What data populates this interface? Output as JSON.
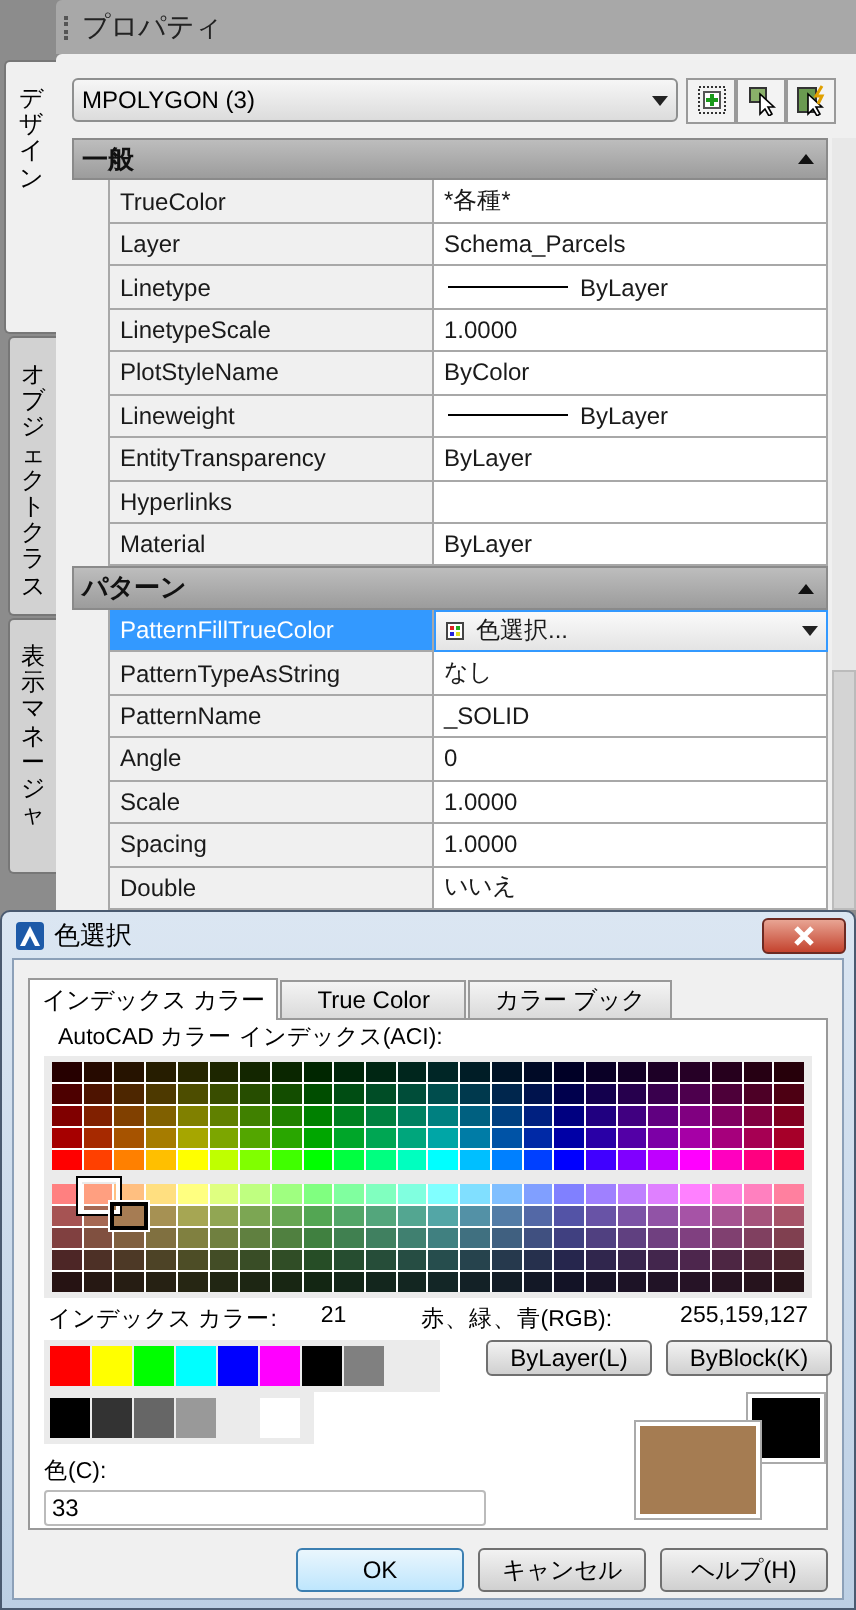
{
  "palette": {
    "title": "プロパティ",
    "side_tabs": [
      {
        "label": "デザイン",
        "selected": true
      },
      {
        "label": "オブジェクトクラス",
        "selected": false
      },
      {
        "label": "表示マネージャ",
        "selected": false
      }
    ],
    "object_select": {
      "value": "MPOLYGON (3)"
    },
    "sections": [
      {
        "title": "一般",
        "expanded": true,
        "rows": [
          {
            "name": "TrueColor",
            "value": "*各種*",
            "kind": "text",
            "selected": false
          },
          {
            "name": "Layer",
            "value": "Schema_Parcels",
            "kind": "text",
            "selected": false
          },
          {
            "name": "Linetype",
            "value": "ByLayer",
            "kind": "line",
            "selected": false
          },
          {
            "name": "LinetypeScale",
            "value": "1.0000",
            "kind": "text",
            "selected": false
          },
          {
            "name": "PlotStyleName",
            "value": "ByColor",
            "kind": "text",
            "selected": false
          },
          {
            "name": "Lineweight",
            "value": "ByLayer",
            "kind": "line",
            "selected": false
          },
          {
            "name": "EntityTransparency",
            "value": "ByLayer",
            "kind": "text",
            "selected": false
          },
          {
            "name": "Hyperlinks",
            "kind": "empty",
            "selected": false
          },
          {
            "name": "Material",
            "value": "ByLayer",
            "kind": "text",
            "selected": false
          }
        ]
      },
      {
        "title": "パターン",
        "expanded": true,
        "rows": [
          {
            "name": "PatternFillTrueColor",
            "value": "色選択...",
            "kind": "color-dropdown",
            "selected": true
          },
          {
            "name": "PatternTypeAsString",
            "value": "なし",
            "kind": "text",
            "selected": false
          },
          {
            "name": "PatternName",
            "value": "_SOLID",
            "kind": "text",
            "selected": false
          },
          {
            "name": "Angle",
            "value": "0",
            "kind": "text",
            "selected": false
          },
          {
            "name": "Scale",
            "value": "1.0000",
            "kind": "text",
            "selected": false
          },
          {
            "name": "Spacing",
            "value": "1.0000",
            "kind": "text",
            "selected": false
          },
          {
            "name": "Double",
            "value": "いいえ",
            "kind": "text",
            "selected": false
          }
        ]
      }
    ]
  },
  "dialog": {
    "title": "色選択",
    "tabs": [
      {
        "label": "インデックス カラー",
        "selected": true
      },
      {
        "label": "True Color",
        "selected": false
      },
      {
        "label": "カラー ブック",
        "selected": false
      }
    ],
    "aci_label": "AutoCAD カラー インデックス(ACI):",
    "index_color": {
      "label": "インデックス カラー:",
      "value": "21"
    },
    "rgb": {
      "label": "赤、緑、青(RGB):",
      "value": "255,159,127"
    },
    "standard_colors": [
      {
        "color": "#ff0000"
      },
      {
        "color": "#ffff00"
      },
      {
        "color": "#00ff00"
      },
      {
        "color": "#00ffff"
      },
      {
        "color": "#0000ff"
      },
      {
        "color": "#ff00ff"
      },
      {
        "color": "#000000"
      },
      {
        "color": "#808080"
      }
    ],
    "gray_colors": [
      {
        "color": "#000000"
      },
      {
        "color": "#333333"
      },
      {
        "color": "#666666"
      },
      {
        "color": "#999999"
      },
      {
        "color": "#ffffff"
      }
    ],
    "bylayer_button": "ByLayer(L)",
    "byblock_button": "ByBlock(K)",
    "color_field": {
      "label": "色(C):",
      "value": "33"
    },
    "preview": {
      "color": "#a57c52"
    },
    "previous": {
      "color": "#000000"
    },
    "buttons": [
      {
        "label": "OK",
        "default": true
      },
      {
        "label": "キャンセル",
        "default": false
      },
      {
        "label": "ヘルプ(H)",
        "default": false
      }
    ]
  }
}
